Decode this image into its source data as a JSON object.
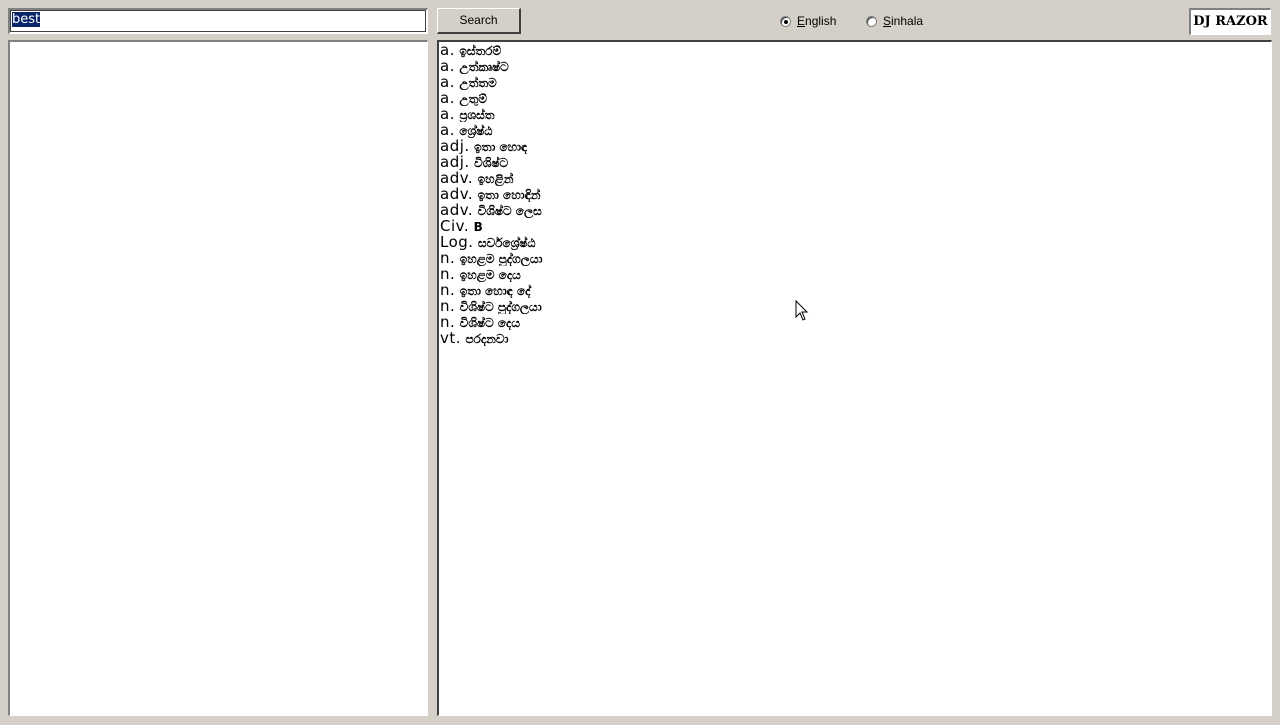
{
  "search": {
    "value": "best"
  },
  "toolbar": {
    "search_label": "Search"
  },
  "language": {
    "english_label_first": "E",
    "english_label_rest": "nglish",
    "sinhala_label_first": "S",
    "sinhala_label_rest": "inhala",
    "selected": "English"
  },
  "brand": {
    "label": "DJ RAZOR"
  },
  "results": [
    {
      "pos": "a.",
      "meaning": "ඉස්තරම්"
    },
    {
      "pos": "a.",
      "meaning": "උත්කෘෂ්ට"
    },
    {
      "pos": "a.",
      "meaning": "උත්තම"
    },
    {
      "pos": "a.",
      "meaning": "උතුම්"
    },
    {
      "pos": "a.",
      "meaning": "ප්‍රශස්ත"
    },
    {
      "pos": "a.",
      "meaning": "ශ්‍රේෂ්ඨ"
    },
    {
      "pos": "adj.",
      "meaning": "ඉතා හොඳ"
    },
    {
      "pos": "adj.",
      "meaning": "විශිෂ්ට"
    },
    {
      "pos": "adv.",
      "meaning": "ඉහළින්"
    },
    {
      "pos": "adv.",
      "meaning": "ඉතා හොඳින්"
    },
    {
      "pos": "adv.",
      "meaning": "විශිෂ්ට ලෙස"
    },
    {
      "pos": "Civ.",
      "meaning": "B"
    },
    {
      "pos": "Log.",
      "meaning": "සර්වශ්‍රේෂ්ඨ"
    },
    {
      "pos": "n.",
      "meaning": "ඉහළම පුද්ගලයා"
    },
    {
      "pos": "n.",
      "meaning": "ඉහළම දෙය"
    },
    {
      "pos": "n.",
      "meaning": "ඉතා හොඳ දේ"
    },
    {
      "pos": "n.",
      "meaning": "විශිෂ්ට පුද්ගලයා"
    },
    {
      "pos": "n.",
      "meaning": "විශිෂ්ට දෙය"
    },
    {
      "pos": "vt.",
      "meaning": "පරදනවා"
    }
  ]
}
